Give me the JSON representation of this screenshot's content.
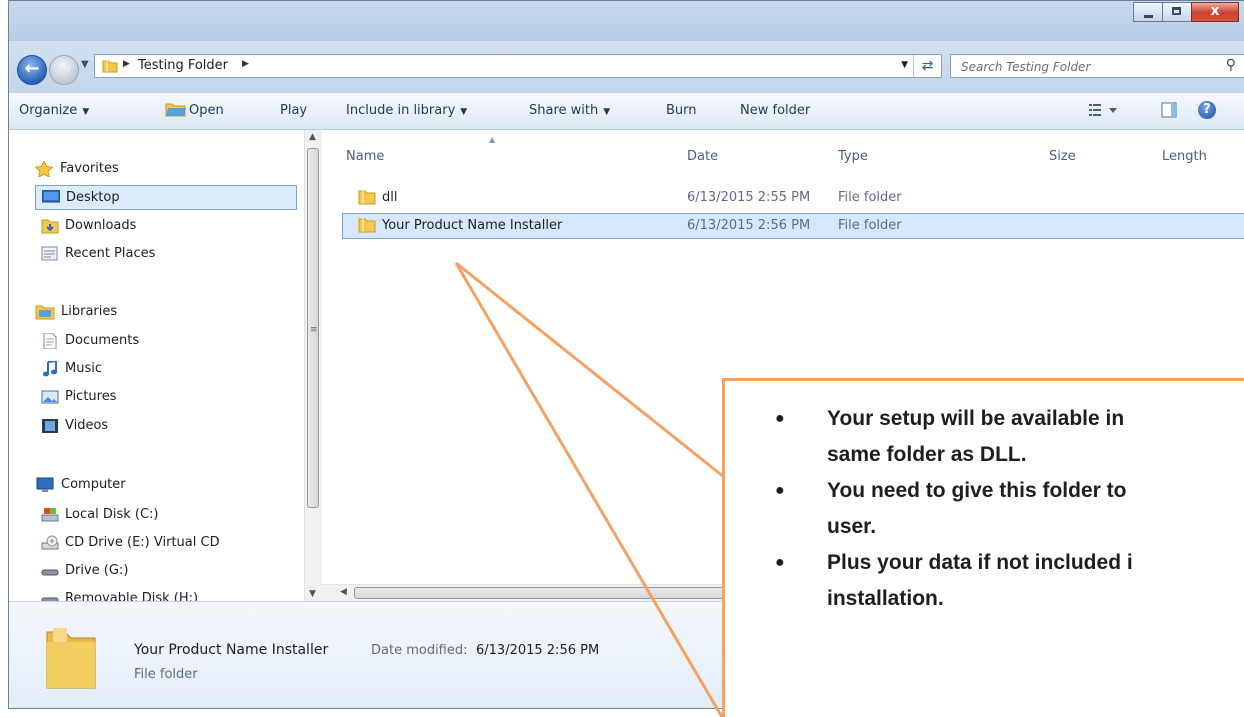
{
  "address": {
    "crumbs": [
      "Testing Folder"
    ],
    "search_placeholder": "Search Testing Folder"
  },
  "toolbar": {
    "organize": "Organize",
    "open": "Open",
    "play": "Play",
    "include_in_library": "Include in library",
    "share_with": "Share with",
    "burn": "Burn",
    "new_folder": "New folder"
  },
  "nav": {
    "favorites": "Favorites",
    "desktop": "Desktop",
    "downloads": "Downloads",
    "recent_places": "Recent Places",
    "libraries": "Libraries",
    "documents": "Documents",
    "music": "Music",
    "pictures": "Pictures",
    "videos": "Videos",
    "computer": "Computer",
    "local_disk": "Local Disk (C:)",
    "cd_drive": "CD Drive (E:) Virtual CD",
    "drive_g": "Drive (G:)",
    "removable": "Removable Disk (H:)"
  },
  "columns": {
    "name": "Name",
    "date": "Date",
    "type": "Type",
    "size": "Size",
    "length": "Length"
  },
  "files": [
    {
      "name": "dll",
      "date": "6/13/2015 2:55 PM",
      "type": "File folder"
    },
    {
      "name": "Your Product Name Installer",
      "date": "6/13/2015 2:56 PM",
      "type": "File folder"
    }
  ],
  "details": {
    "name": "Your Product Name Installer",
    "modified_label": "Date modified:",
    "modified_value": "6/13/2015 2:56 PM",
    "kind": "File folder"
  },
  "callout": {
    "bullets": [
      {
        "line1": "Your setup will be available in",
        "line2": "same folder as DLL."
      },
      {
        "line1": "You need to give this folder to",
        "line2": "user."
      },
      {
        "line1": "Plus your data if not included i",
        "line2": "installation."
      }
    ],
    "accent": "#f4a261"
  }
}
